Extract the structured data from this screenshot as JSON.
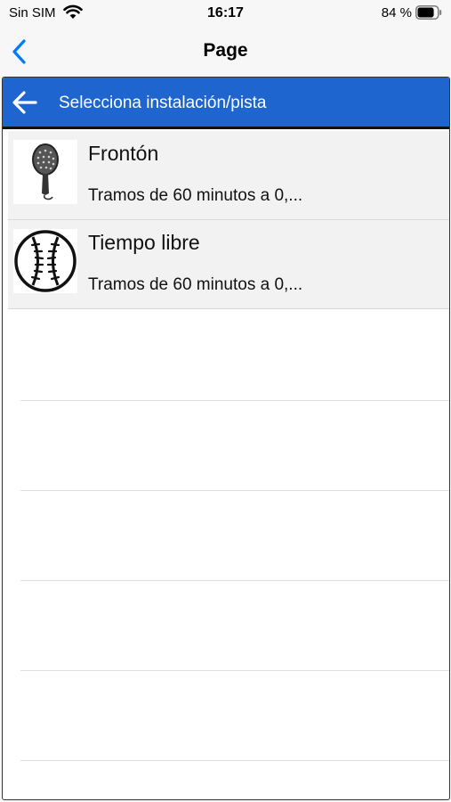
{
  "status": {
    "carrier": "Sin SIM",
    "time": "16:17",
    "battery": "84 %",
    "battery_level": 0.84,
    "icons": [
      "wifi-icon",
      "battery-icon"
    ]
  },
  "navbar": {
    "title": "Page",
    "back_icon": "chevron-left-icon"
  },
  "appbar": {
    "title": "Selecciona instalación/pista",
    "back_icon": "arrow-left-icon",
    "color": "#1e65cf"
  },
  "items": [
    {
      "title": "Frontón",
      "subtitle": "Tramos de 60 minutos a 0,...",
      "icon": "paddle-racket-icon"
    },
    {
      "title": "Tiempo libre",
      "subtitle": "Tramos de 60 minutos a 0,...",
      "icon": "baseball-icon"
    }
  ],
  "colors": {
    "accent": "#007aff"
  }
}
